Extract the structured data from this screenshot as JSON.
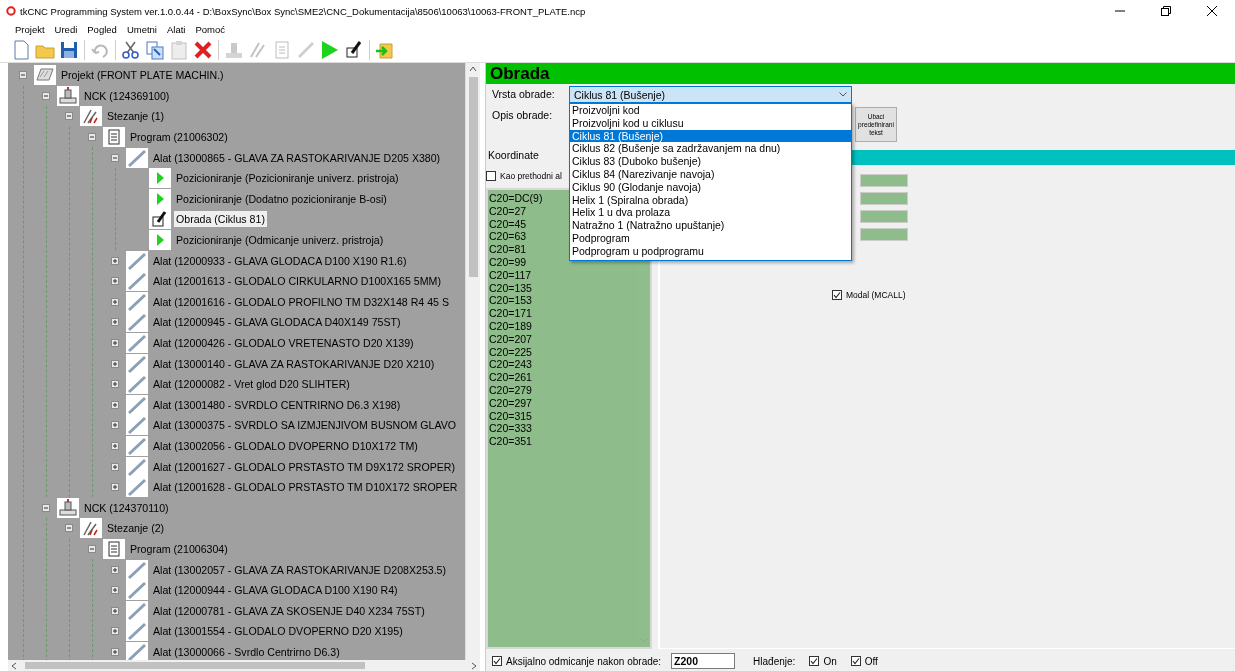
{
  "window": {
    "title": "tkCNC Programming System ver.1.0.0.44 - D:\\BoxSync\\Box Sync\\SME2\\CNC_Dokumentacija\\8506\\10063\\10063-FRONT_PLATE.ncp"
  },
  "menu": [
    "Projekt",
    "Uredi",
    "Pogled",
    "Umetni",
    "Alati",
    "Pomoć"
  ],
  "toolbar": [
    [
      {
        "kind": "new",
        "disabled": false
      },
      {
        "kind": "open",
        "disabled": false
      },
      {
        "kind": "save",
        "disabled": false
      }
    ],
    [
      {
        "kind": "undo",
        "disabled": true
      }
    ],
    [
      {
        "kind": "cut",
        "disabled": false
      },
      {
        "kind": "copy",
        "disabled": false
      },
      {
        "kind": "paste",
        "disabled": true
      },
      {
        "kind": "delete",
        "disabled": false
      }
    ],
    [
      {
        "kind": "machine",
        "disabled": true
      },
      {
        "kind": "clamp",
        "disabled": true
      },
      {
        "kind": "program",
        "disabled": true
      },
      {
        "kind": "tool",
        "disabled": true
      },
      {
        "kind": "position",
        "disabled": false
      },
      {
        "kind": "operation",
        "disabled": false
      }
    ],
    [
      {
        "kind": "exit",
        "disabled": false
      }
    ]
  ],
  "tree": [
    {
      "kind": "project",
      "label": "Projekt (FRONT PLATE MACHIN.)",
      "expanded": true,
      "selected": false,
      "children": [
        {
          "kind": "machine",
          "label": "NCK (124369100)",
          "expanded": true,
          "selected": false,
          "children": [
            {
              "kind": "clamp",
              "label": "Stezanje (1)",
              "expanded": true,
              "selected": false,
              "children": [
                {
                  "kind": "program",
                  "label": "Program (21006302)",
                  "expanded": true,
                  "selected": false,
                  "children": [
                    {
                      "kind": "tool",
                      "label": "Alat (13000865 - GLAVA ZA RASTOKARIVANJE D205 X380)",
                      "expanded": true,
                      "selected": false,
                      "children": [
                        {
                          "kind": "position",
                          "label": "Pozicioniranje (Pozicioniranje univerz. pristroja)",
                          "selected": false
                        },
                        {
                          "kind": "position",
                          "label": "Pozicioniranje (Dodatno pozicioniranje B-osi)",
                          "selected": false
                        },
                        {
                          "kind": "operation",
                          "label": "Obrada (Ciklus 81)",
                          "selected": true
                        },
                        {
                          "kind": "position",
                          "label": "Pozicioniranje (Odmicanje univerz. pristroja)",
                          "selected": false
                        }
                      ]
                    },
                    {
                      "kind": "tool",
                      "label": "Alat (12000933 - GLAVA GLODACA D100 X190 R1.6)",
                      "expanded": false,
                      "selected": false
                    },
                    {
                      "kind": "tool",
                      "label": "Alat (12001613 - GLODALO CIRKULARNO D100X165 5MM)",
                      "expanded": false,
                      "selected": false
                    },
                    {
                      "kind": "tool",
                      "label": "Alat (12001616 - GLODALO PROFILNO TM D32X148 R4 45 S",
                      "expanded": false,
                      "selected": false
                    },
                    {
                      "kind": "tool",
                      "label": "Alat (12000945 - GLAVA GLODACA D40X149 75ST)",
                      "expanded": false,
                      "selected": false
                    },
                    {
                      "kind": "tool",
                      "label": "Alat (12000426 - GLODALO VRETENASTO D20 X139)",
                      "expanded": false,
                      "selected": false
                    },
                    {
                      "kind": "tool",
                      "label": "Alat (13000140 - GLAVA ZA RASTOKARIVANJE D20 X210)",
                      "expanded": false,
                      "selected": false
                    },
                    {
                      "kind": "tool",
                      "label": "Alat (12000082 - Vret glod D20 SLIHTER)",
                      "expanded": false,
                      "selected": false
                    },
                    {
                      "kind": "tool",
                      "label": "Alat (13001480 - SVRDLO CENTRIRNO D6.3 X198)",
                      "expanded": false,
                      "selected": false
                    },
                    {
                      "kind": "tool",
                      "label": "Alat (13000375 - SVRDLO SA IZMJENJIVOM BUSNOM GLAVO",
                      "expanded": false,
                      "selected": false
                    },
                    {
                      "kind": "tool",
                      "label": "Alat (13002056 - GLODALO DVOPERNO D10X172 TM)",
                      "expanded": false,
                      "selected": false
                    },
                    {
                      "kind": "tool",
                      "label": "Alat (12001627 - GLODALO PRSTASTO TM D9X172 SROPER)",
                      "expanded": false,
                      "selected": false
                    },
                    {
                      "kind": "tool",
                      "label": "Alat (12001628 - GLODALO PRSTASTO TM D10X172 SROPER",
                      "expanded": false,
                      "selected": false
                    }
                  ]
                }
              ]
            }
          ]
        },
        {
          "kind": "machine",
          "label": "NCK (124370110)",
          "expanded": true,
          "selected": false,
          "children": [
            {
              "kind": "clamp",
              "label": "Stezanje (2)",
              "expanded": true,
              "selected": false,
              "children": [
                {
                  "kind": "program",
                  "label": "Program (21006304)",
                  "expanded": true,
                  "selected": false,
                  "children": [
                    {
                      "kind": "tool",
                      "label": "Alat (13002057 - GLAVA ZA RASTOKARIVANJE D208X253.5)",
                      "expanded": false,
                      "selected": false
                    },
                    {
                      "kind": "tool",
                      "label": "Alat (12000944 - GLAVA GLODACA D100 X190 R4)",
                      "expanded": false,
                      "selected": false
                    },
                    {
                      "kind": "tool",
                      "label": "Alat (12000781 - GLAVA ZA SKOSENJE D40 X234 75ST)",
                      "expanded": false,
                      "selected": false
                    },
                    {
                      "kind": "tool",
                      "label": "Alat (13001554 - GLODALO DVOPERNO D20 X195)",
                      "expanded": false,
                      "selected": false
                    },
                    {
                      "kind": "tool",
                      "label": "Alat (13000066 - Svrdlo Centrirno D6.3)",
                      "expanded": false,
                      "selected": false
                    }
                  ]
                }
              ]
            }
          ]
        }
      ]
    }
  ],
  "panel": {
    "title": "Obrada",
    "type_label": "Vrsta obrade:",
    "type_value": "Ciklus 81 (Bušenje)",
    "type_options": [
      {
        "label": "Proizvoljni kod",
        "selected": false
      },
      {
        "label": "Proizvoljni kod u ciklusu",
        "selected": false
      },
      {
        "label": "Ciklus 81 (Bušenje)",
        "selected": true
      },
      {
        "label": "Ciklus 82 (Bušenje sa zadržavanjem na dnu)",
        "selected": false
      },
      {
        "label": "Ciklus 83 (Duboko bušenje)",
        "selected": false
      },
      {
        "label": "Ciklus 84 (Narezivanje navoja)",
        "selected": false
      },
      {
        "label": "Ciklus 90 (Glodanje navoja)",
        "selected": false
      },
      {
        "label": "Helix 1 (Spiralna obrada)",
        "selected": false
      },
      {
        "label": "Helix 1 u dva prolaza",
        "selected": false
      },
      {
        "label": "Natražno 1 (Natražno upuštanje)",
        "selected": false
      },
      {
        "label": "Podprogram",
        "selected": false
      },
      {
        "label": "Podprogram u podprogramu",
        "selected": false
      }
    ],
    "description_label": "Opis obrade:",
    "insert_button": "Ubaci predefinirani tekst",
    "coordinates_title": "Koordinate",
    "same_as_previous": {
      "label": "Kao prethodni al",
      "checked": false
    },
    "positions": [
      "C20=DC(9)",
      "C20=27",
      "C20=45",
      "C20=63",
      "C20=81",
      "C20=99",
      "C20=117",
      "C20=135",
      "C20=153",
      "C20=171",
      "C20=189",
      "C20=207",
      "C20=225",
      "C20=243",
      "C20=261",
      "C20=279",
      "C20=297",
      "C20=315",
      "C20=333",
      "C20=351"
    ],
    "modal": {
      "label": "Modal (MCALL)",
      "checked": true
    }
  },
  "bottom": {
    "retract": {
      "label": "Aksijalno odmicanje nakon obrade:",
      "checked": true,
      "value": "Z200"
    },
    "cooling_label": "Hlađenje:",
    "cooling": [
      {
        "label": "On",
        "checked": true
      },
      {
        "label": "Off",
        "checked": true
      }
    ]
  }
}
